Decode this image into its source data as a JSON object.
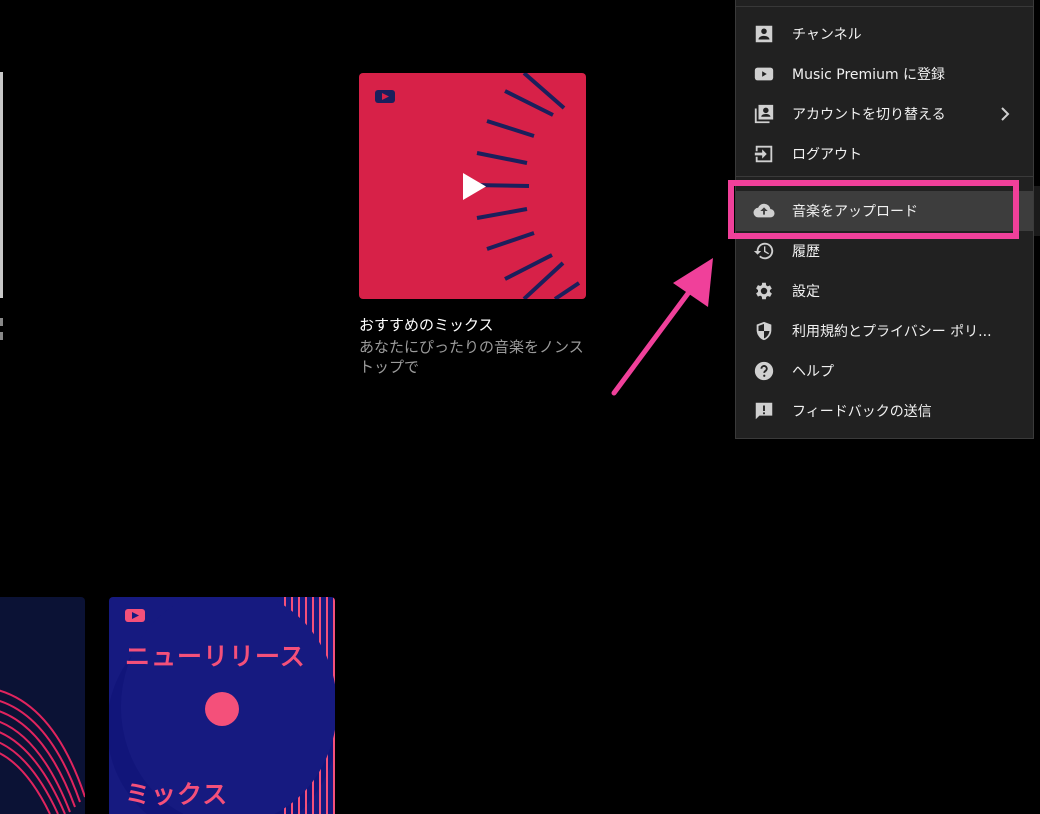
{
  "mix_card": {
    "title": "おすすめのミックス",
    "subtitle": "あなたにぴったりの音楽をノンストップで"
  },
  "new_release_card": {
    "title": "ニューリリース",
    "mix_label": "ミックス"
  },
  "menu": {
    "items": [
      {
        "label": "チャンネル",
        "icon": "account-box-icon"
      },
      {
        "label": "Music Premium に登録",
        "icon": "youtube-icon"
      },
      {
        "label": "アカウントを切り替える",
        "icon": "switch-account-icon",
        "has_submenu": true
      },
      {
        "label": "ログアウト",
        "icon": "logout-icon"
      },
      {
        "label": "音楽をアップロード",
        "icon": "cloud-upload-icon",
        "highlighted": true
      },
      {
        "label": "履歴",
        "icon": "history-icon"
      },
      {
        "label": "設定",
        "icon": "gear-icon"
      },
      {
        "label": "利用規約とプライバシー ポリ...",
        "icon": "shield-icon"
      },
      {
        "label": "ヘルプ",
        "icon": "help-icon"
      },
      {
        "label": "フィードバックの送信",
        "icon": "feedback-icon"
      }
    ]
  },
  "colors": {
    "menu_bg": "#212121",
    "highlight": "#f0409a",
    "mix_card": "#d72148",
    "new_release_card": "#161a80"
  }
}
